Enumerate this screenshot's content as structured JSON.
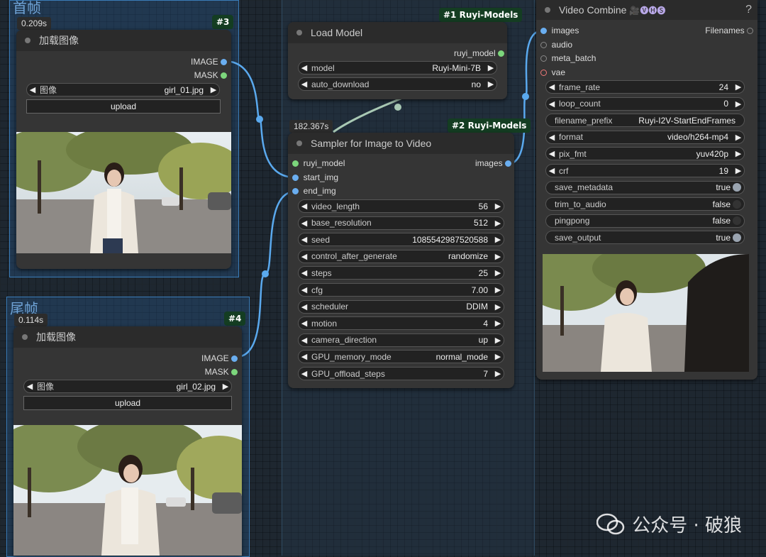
{
  "groups": {
    "first_frame": "首帧",
    "last_frame": "尾帧"
  },
  "load_image_1": {
    "badge": "#3",
    "time": "0.209s",
    "title": "加载图像",
    "out_image": "IMAGE",
    "out_mask": "MASK",
    "image_label": "图像",
    "image_value": "girl_01.jpg",
    "upload": "upload"
  },
  "load_image_2": {
    "badge": "#4",
    "time": "0.114s",
    "title": "加载图像",
    "out_image": "IMAGE",
    "out_mask": "MASK",
    "image_label": "图像",
    "image_value": "girl_02.jpg",
    "upload": "upload"
  },
  "load_model": {
    "badge": "#1 Ruyi-Models",
    "title": "Load Model",
    "output": "ruyi_model",
    "widgets": [
      {
        "label": "model",
        "value": "Ruyi-Mini-7B"
      },
      {
        "label": "auto_download",
        "value": "no"
      }
    ]
  },
  "sampler": {
    "badge": "#2 Ruyi-Models",
    "time": "182.367s",
    "title": "Sampler for Image to Video",
    "inputs": [
      "ruyi_model",
      "start_img",
      "end_img"
    ],
    "output": "images",
    "widgets": [
      {
        "label": "video_length",
        "value": "56"
      },
      {
        "label": "base_resolution",
        "value": "512"
      },
      {
        "label": "seed",
        "value": "1085542987520588"
      },
      {
        "label": "control_after_generate",
        "value": "randomize"
      },
      {
        "label": "steps",
        "value": "25"
      },
      {
        "label": "cfg",
        "value": "7.00"
      },
      {
        "label": "scheduler",
        "value": "DDIM"
      },
      {
        "label": "motion",
        "value": "4"
      },
      {
        "label": "camera_direction",
        "value": "up"
      },
      {
        "label": "GPU_memory_mode",
        "value": "normal_mode"
      },
      {
        "label": "GPU_offload_steps",
        "value": "7"
      }
    ]
  },
  "video_combine": {
    "title": "Video Combine",
    "title_icons": "🎥🅥🅗🅢",
    "help": "?",
    "inputs": [
      "images",
      "audio",
      "meta_batch",
      "vae"
    ],
    "output": "Filenames",
    "widgets": [
      {
        "label": "frame_rate",
        "value": "24",
        "kind": "number"
      },
      {
        "label": "loop_count",
        "value": "0",
        "kind": "number"
      },
      {
        "label": "filename_prefix",
        "value": "Ruyi-I2V-StartEndFrames",
        "kind": "text"
      },
      {
        "label": "format",
        "value": "video/h264-mp4",
        "kind": "combo"
      },
      {
        "label": "pix_fmt",
        "value": "yuv420p",
        "kind": "combo"
      },
      {
        "label": "crf",
        "value": "19",
        "kind": "number"
      },
      {
        "label": "save_metadata",
        "value": "true",
        "kind": "toggle"
      },
      {
        "label": "trim_to_audio",
        "value": "false",
        "kind": "toggle"
      },
      {
        "label": "pingpong",
        "value": "false",
        "kind": "toggle"
      },
      {
        "label": "save_output",
        "value": "true",
        "kind": "toggle"
      }
    ]
  },
  "watermark": {
    "text": "公众号 · 破狼",
    "icon": "wechat-icon"
  },
  "colors": {
    "link": "#5aa9ee",
    "model_link": "#a9c9b4",
    "badge_bg": "#143d22",
    "group_border": "#3a7cb8",
    "port_blue": "#6aaef0",
    "port_green": "#7cd67c",
    "port_red": "#f07878"
  }
}
